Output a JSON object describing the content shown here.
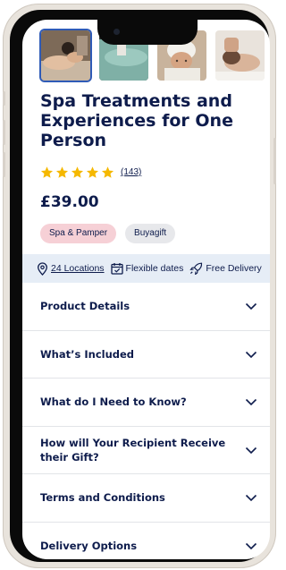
{
  "product": {
    "title": "Spa Treatments and Experiences for One Person",
    "rating_stars": 5,
    "review_count": "(143)",
    "price": "£39.00",
    "tags": [
      "Spa & Pamper",
      "Buyagift"
    ]
  },
  "info_strip": {
    "locations": "24 Locations",
    "dates": "Flexible dates",
    "delivery": "Free Delivery"
  },
  "accordion": {
    "items": [
      "Product Details",
      "What’s Included",
      "What do I Need to Know?",
      "How will Your Recipient Receive their Gift?",
      "Terms and Conditions",
      "Delivery Options"
    ]
  },
  "colors": {
    "navy": "#0e1c4c",
    "star": "#f5b800",
    "tag_pink": "#f6d0d6",
    "strip": "#e6edf6"
  }
}
